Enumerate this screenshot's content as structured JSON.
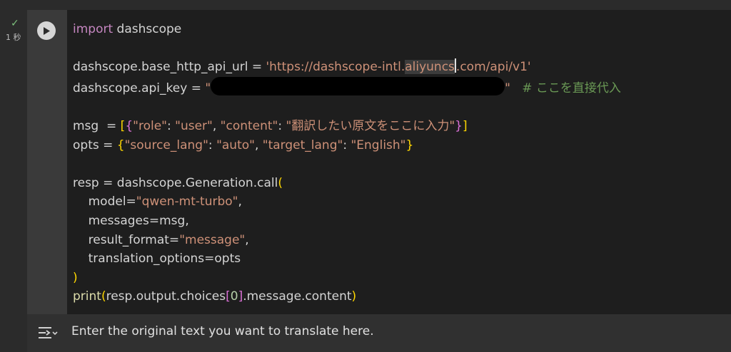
{
  "cell": {
    "status_check": "✓",
    "exec_time": "1 秒",
    "code": {
      "line1_kw": "import",
      "line1_mod": " dashscope",
      "line3_a": "dashscope.base_http_api_url = ",
      "line3_str1": "'https://dashscope-intl.",
      "line3_str2": "aliyuncs",
      "line3_str3": ".com/api/v1'",
      "line4_a": "dashscope.api_key = ",
      "line4_q1": "\"",
      "line4_q2": "\"",
      "line4_comment": "# ここを直接代入",
      "line6_a": "msg  = ",
      "line6_key1": "\"role\"",
      "line6_sep1": ": ",
      "line6_val1": "\"user\"",
      "line6_comma": ", ",
      "line6_key2": "\"content\"",
      "line6_sep2": ": ",
      "line6_val2": "\"翻訳したい原文をここに入力\"",
      "line7_a": "opts = ",
      "line7_key1": "\"source_lang\"",
      "line7_sep1": ": ",
      "line7_val1": "\"auto\"",
      "line7_comma": ", ",
      "line7_key2": "\"target_lang\"",
      "line7_sep2": ": ",
      "line7_val2": "\"English\"",
      "line9_a": "resp = dashscope.Generation.call",
      "line10_a": "    model=",
      "line10_str": "\"qwen-mt-turbo\"",
      "line10_b": ",",
      "line11": "    messages=msg,",
      "line12_a": "    result_format=",
      "line12_str": "\"message\"",
      "line12_b": ",",
      "line13": "    translation_options=opts",
      "line14": ")",
      "line15_fn": "print",
      "line15_a": "resp.output.choices",
      "line15_num": "0",
      "line15_b": ".message.content"
    }
  },
  "output": {
    "text": "Enter the original text you want to translate here."
  },
  "colors": {
    "keyword": "#c586c0",
    "string": "#ce9178",
    "comment": "#6a9955",
    "bracket_outer": "#ffd700",
    "bracket_inner": "#da70d6",
    "status_ok": "#7ec27e"
  },
  "icons": {
    "run": "play-icon",
    "status": "check-icon",
    "output_toggle": "output-toggle-icon"
  }
}
